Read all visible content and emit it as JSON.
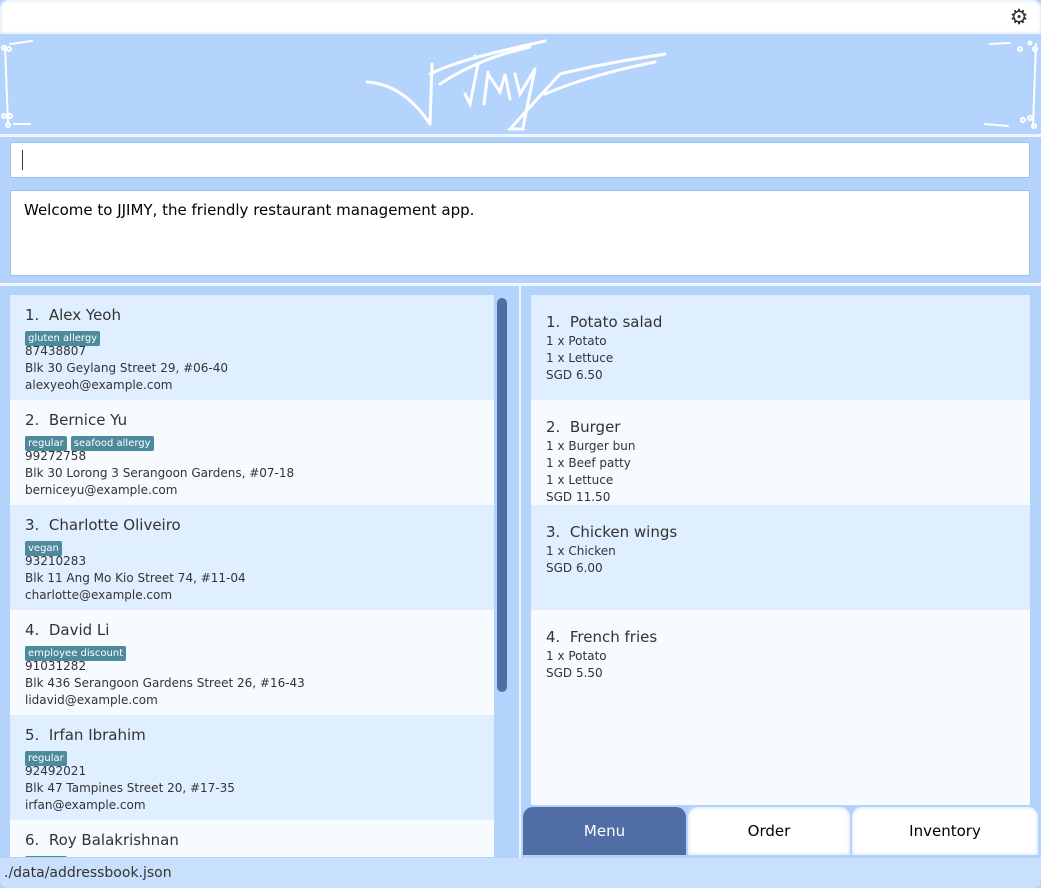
{
  "app": {
    "logo_text": "JJIMY",
    "settings_icon": "gear-icon"
  },
  "command": {
    "value": "",
    "placeholder": ""
  },
  "result": {
    "message": "Welcome to JJIMY, the friendly restaurant management app."
  },
  "persons": [
    {
      "index": "1.",
      "name": "Alex Yeoh",
      "tags": [
        "gluten allergy"
      ],
      "phone": "87438807",
      "address": "Blk 30 Geylang Street 29, #06-40",
      "email": "alexyeoh@example.com"
    },
    {
      "index": "2.",
      "name": "Bernice Yu",
      "tags": [
        "regular",
        "seafood allergy"
      ],
      "phone": "99272758",
      "address": "Blk 30 Lorong 3 Serangoon Gardens, #07-18",
      "email": "berniceyu@example.com"
    },
    {
      "index": "3.",
      "name": "Charlotte Oliveiro",
      "tags": [
        "vegan"
      ],
      "phone": "93210283",
      "address": "Blk 11 Ang Mo Kio Street 74, #11-04",
      "email": "charlotte@example.com"
    },
    {
      "index": "4.",
      "name": "David Li",
      "tags": [
        "employee discount"
      ],
      "phone": "91031282",
      "address": "Blk 436 Serangoon Gardens Street 26, #16-43",
      "email": "lidavid@example.com"
    },
    {
      "index": "5.",
      "name": "Irfan Ibrahim",
      "tags": [
        "regular"
      ],
      "phone": "92492021",
      "address": "Blk 47 Tampines Street 20, #17-35",
      "email": "irfan@example.com"
    },
    {
      "index": "6.",
      "name": "Roy Balakrishnan",
      "tags": [
        "regular"
      ]
    }
  ],
  "menu": [
    {
      "index": "1.",
      "name": "Potato salad",
      "ingredients": [
        "1 x Potato",
        "1 x Lettuce"
      ],
      "price": "SGD 6.50"
    },
    {
      "index": "2.",
      "name": "Burger",
      "ingredients": [
        "1 x Burger bun",
        "1 x Beef patty",
        "1 x Lettuce"
      ],
      "price": "SGD 11.50"
    },
    {
      "index": "3.",
      "name": "Chicken wings",
      "ingredients": [
        "1 x Chicken"
      ],
      "price": "SGD 6.00"
    },
    {
      "index": "4.",
      "name": "French fries",
      "ingredients": [
        "1 x Potato"
      ],
      "price": "SGD 5.50"
    }
  ],
  "tabs": [
    {
      "label": "Menu",
      "active": true
    },
    {
      "label": "Order",
      "active": false
    },
    {
      "label": "Inventory",
      "active": false
    }
  ],
  "status": {
    "file_path": "./data/addressbook.json"
  },
  "colors": {
    "accent": "#506ea5",
    "tag": "#4c8a9c",
    "background": "#b3d3fc"
  }
}
